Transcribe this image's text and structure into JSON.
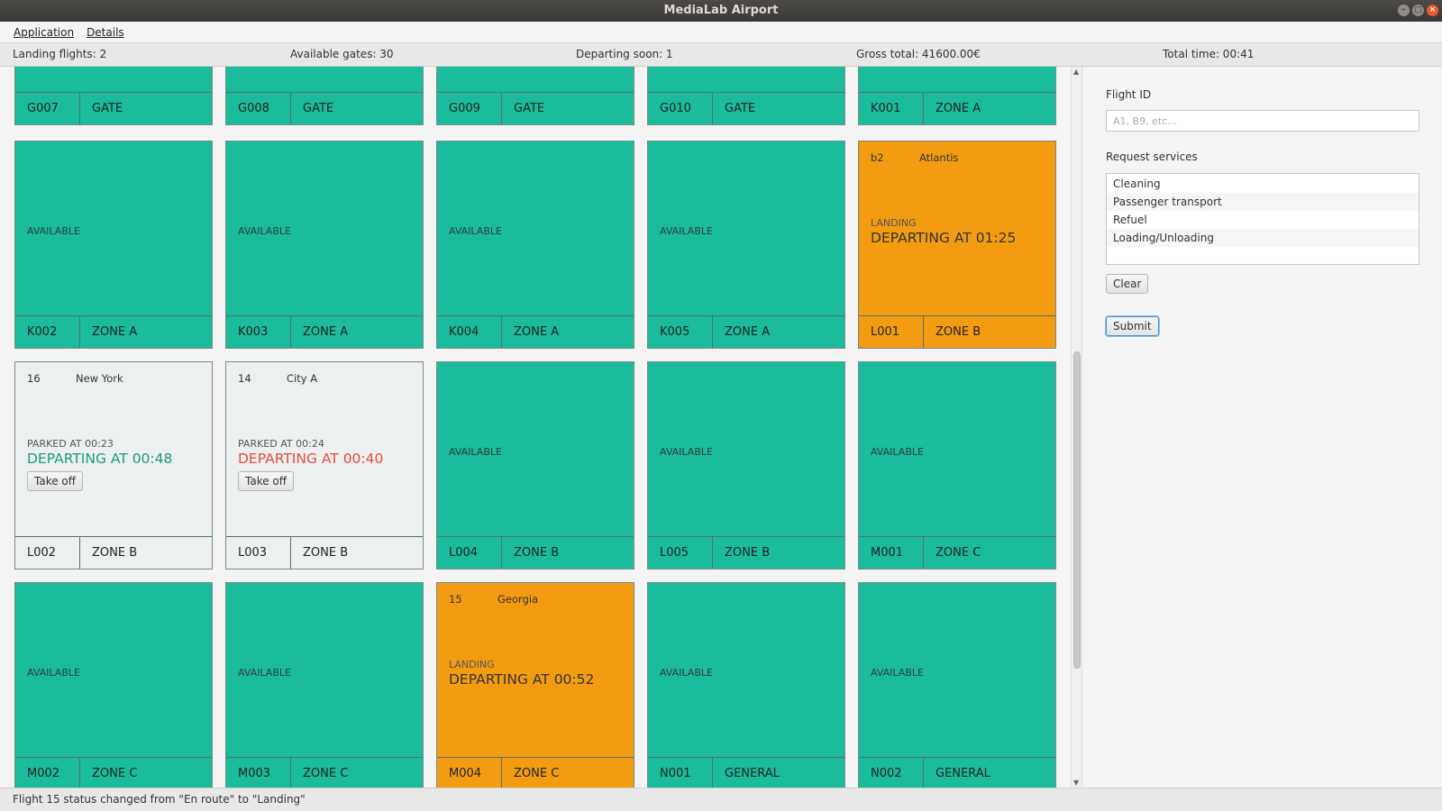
{
  "window": {
    "title": "MediaLab Airport"
  },
  "menu": [
    "Application",
    "Details"
  ],
  "status": {
    "landing": "Landing flights: 2",
    "gates": "Available gates: 30",
    "departing": "Departing soon: 1",
    "gross": "Gross total: 41600.00€",
    "time": "Total time: 00:41"
  },
  "gates": [
    {
      "code": "G007",
      "zone": "GATE",
      "state": "available",
      "status_text": ""
    },
    {
      "code": "G008",
      "zone": "GATE",
      "state": "available",
      "status_text": ""
    },
    {
      "code": "G009",
      "zone": "GATE",
      "state": "available",
      "status_text": ""
    },
    {
      "code": "G010",
      "zone": "GATE",
      "state": "available",
      "status_text": ""
    },
    {
      "code": "K001",
      "zone": "ZONE A",
      "state": "available",
      "status_text": ""
    },
    {
      "code": "K002",
      "zone": "ZONE A",
      "state": "available",
      "status_text": "AVAILABLE"
    },
    {
      "code": "K003",
      "zone": "ZONE A",
      "state": "available",
      "status_text": "AVAILABLE"
    },
    {
      "code": "K004",
      "zone": "ZONE A",
      "state": "available",
      "status_text": "AVAILABLE"
    },
    {
      "code": "K005",
      "zone": "ZONE A",
      "state": "available",
      "status_text": "AVAILABLE"
    },
    {
      "code": "L001",
      "zone": "ZONE B",
      "state": "landing",
      "flight": "b2",
      "dest": "Atlantis",
      "status_text": "LANDING",
      "departing": "DEPARTING AT 01:25"
    },
    {
      "code": "L002",
      "zone": "ZONE B",
      "state": "parked",
      "flight": "16",
      "dest": "New York",
      "status_text": "PARKED AT 00:23",
      "departing": "DEPARTING AT 00:48",
      "dep_color": "ok",
      "action": "Take off"
    },
    {
      "code": "L003",
      "zone": "ZONE B",
      "state": "parked",
      "flight": "14",
      "dest": "City A",
      "status_text": "PARKED AT 00:24",
      "departing": "DEPARTING AT 00:40",
      "dep_color": "late",
      "action": "Take off"
    },
    {
      "code": "L004",
      "zone": "ZONE B",
      "state": "available",
      "status_text": "AVAILABLE"
    },
    {
      "code": "L005",
      "zone": "ZONE B",
      "state": "available",
      "status_text": "AVAILABLE"
    },
    {
      "code": "M001",
      "zone": "ZONE C",
      "state": "available",
      "status_text": "AVAILABLE"
    },
    {
      "code": "M002",
      "zone": "ZONE C",
      "state": "available",
      "status_text": "AVAILABLE"
    },
    {
      "code": "M003",
      "zone": "ZONE C",
      "state": "available",
      "status_text": "AVAILABLE"
    },
    {
      "code": "M004",
      "zone": "ZONE C",
      "state": "landing",
      "flight": "15",
      "dest": "Georgia",
      "status_text": "LANDING",
      "departing": "DEPARTING AT 00:52"
    },
    {
      "code": "N001",
      "zone": "GENERAL",
      "state": "available",
      "status_text": "AVAILABLE"
    },
    {
      "code": "N002",
      "zone": "GENERAL",
      "state": "available",
      "status_text": "AVAILABLE"
    }
  ],
  "side": {
    "flight_label": "Flight ID",
    "flight_placeholder": "A1, B9, etc...",
    "flight_value": "",
    "services_label": "Request services",
    "services": [
      "Cleaning",
      "Passenger transport",
      "Refuel",
      "Loading/Unloading"
    ],
    "clear": "Clear",
    "submit": "Submit"
  },
  "footer": "Flight 15 status changed from \"En route\" to \"Landing\"",
  "colors": {
    "available": "#1abc9c",
    "landing": "#f39c12",
    "parked": "#ecf0f1",
    "departing_ok": "#1a9a80",
    "departing_late": "#e74c3c"
  }
}
